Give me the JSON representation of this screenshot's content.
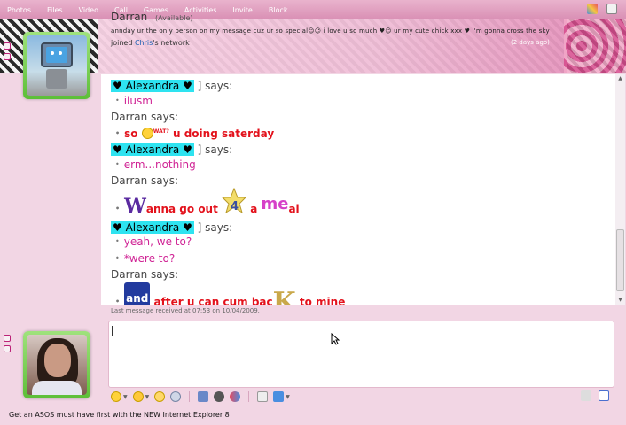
{
  "menu": {
    "items": [
      "Photos",
      "Files",
      "Video",
      "Call",
      "Games",
      "Activities",
      "Invite",
      "Block"
    ]
  },
  "contact": {
    "name": "Darran",
    "status": "(Available)",
    "personal_message": "annday ur the only person on my message cuz ur so special☺☺ i love u so much ♥☺ ur my cute chick xxx ♥ i'm gonna cross the sky",
    "joined_prefix": "joined",
    "joined_link": "Chris",
    "joined_suffix": "'s network",
    "days_ago": "(2 days ago)"
  },
  "conversation": {
    "lines": [
      {
        "type": "says",
        "who": "♥ Alexandra ♥",
        "suffix": "] says:"
      },
      {
        "type": "msg",
        "text": "ilusm"
      },
      {
        "type": "says_plain",
        "text": "Darran says:"
      },
      {
        "type": "msg_red",
        "pre": "so",
        "wat": "WAT?",
        "post": "u doing saterday"
      },
      {
        "type": "says",
        "who": "♥ Alexandra ♥",
        "suffix": "] says:"
      },
      {
        "type": "msg",
        "text": "erm...nothing"
      },
      {
        "type": "says_plain",
        "text": "Darran says:"
      },
      {
        "type": "msg_big1",
        "a": "W",
        "b": "anna go out",
        "c": "4",
        "d": "a",
        "e": "me",
        "f": "al"
      },
      {
        "type": "says",
        "who": "♥ Alexandra ♥",
        "suffix": "] says:"
      },
      {
        "type": "msg",
        "text": "yeah, we to?"
      },
      {
        "type": "msg",
        "text": "*were to?"
      },
      {
        "type": "says_plain",
        "text": "Darran says:"
      },
      {
        "type": "msg_big2",
        "a": "and",
        "b": "after u can cum bac",
        "c": "K",
        "d": "to mine"
      }
    ]
  },
  "last_message": "Last message received at 07:53 on 10/04/2009.",
  "input": {
    "value": ""
  },
  "ad": {
    "text": "Get an ASOS must have first with the NEW Internet Explorer 8"
  },
  "colors": {
    "accent": "#d98fb4",
    "alexandra_highlight": "#2ee3f0",
    "pink_text": "#d02495",
    "red_text": "#e3121c"
  }
}
